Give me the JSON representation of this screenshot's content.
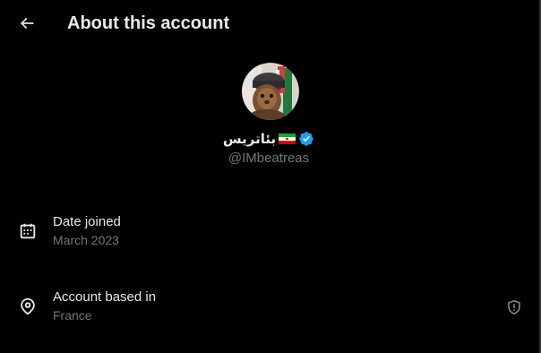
{
  "header": {
    "back_icon": "arrow-left-icon",
    "title": "About this account"
  },
  "profile": {
    "avatar_icon": "avatar-image",
    "display_name": "بئاتریس",
    "flag_icon": "iran-flag-icon",
    "verified_icon": "verified-badge-icon",
    "handle": "@IMbeatreas"
  },
  "details": [
    {
      "icon": "calendar-icon",
      "label": "Date joined",
      "value": "March 2023"
    },
    {
      "icon": "location-pin-icon",
      "label": "Account based in",
      "value": "France",
      "action_icon": "shield-alert-icon"
    }
  ],
  "colors": {
    "background": "#000000",
    "primary_text": "#e7e9ea",
    "secondary_text": "#71767b",
    "verified_blue": "#1d9bf0"
  }
}
